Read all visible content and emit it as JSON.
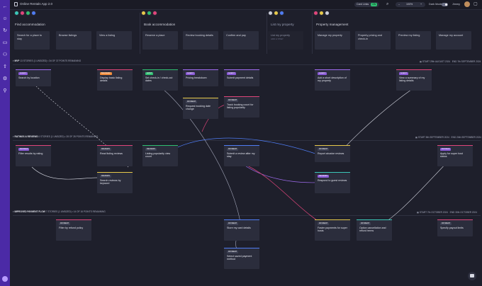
{
  "app": {
    "title": "Online Rentals App 2.0"
  },
  "topbar": {
    "card_links_label": "Card Links",
    "card_links_state": "ON",
    "zoom_out": "–",
    "zoom_level": "100%",
    "zoom_in": "+",
    "dark_mode_label": "Dark Mode",
    "user_name": "Jimmy",
    "search_icon": "search-icon"
  },
  "colors": {
    "left_rail": "#4b2aa6",
    "background": "#1e1f2b",
    "card": "#2b2d3c",
    "pink": "#e0457b",
    "green": "#2fbf71",
    "purple": "#a06cf0",
    "blue": "#4f7cf3",
    "yellow": "#e7c94a",
    "orange": "#f08b3a",
    "teal": "#3bc7b8"
  },
  "activities": [
    {
      "label": "Find accommodation"
    },
    {
      "label": "Book accommodation"
    },
    {
      "label": "List my property"
    },
    {
      "label": "Property management"
    }
  ],
  "steps": [
    {
      "label": "Search for a place to stay"
    },
    {
      "label": "Browse listings"
    },
    {
      "label": "View a listing"
    },
    {
      "label": "Reserve a place"
    },
    {
      "label": "Review booking details"
    },
    {
      "label": "Confirm and pay"
    },
    {
      "label": "List my property",
      "sub": "ADD A STEP"
    },
    {
      "label": "Manage my property"
    },
    {
      "label": "Property pricing and check-in"
    },
    {
      "label": "Preview my listing"
    },
    {
      "label": "Manage my account"
    }
  ],
  "releases": [
    {
      "name": "MVP",
      "stats": "13 STORIES (1 UNSIZED) • 34 OF 37 POINTS REMAINING",
      "start_label": "START",
      "start": "29th AUGUST 2024",
      "end_label": "END",
      "end": "7th SEPTEMBER 2024"
    },
    {
      "name": "RATINGS & REVIEWS",
      "stats": "6 STORIES (1 UNSIZED) • 28 OF 28 POINTS REMAINING",
      "start_label": "START",
      "start": "8th SEPTEMBER 2024",
      "end_label": "END",
      "end": "26th SEPTEMBER 2024"
    },
    {
      "name": "IMPROVED PAYMENT FLOW",
      "stats": "7 STORIES (1 UNSIZED) • 14 OF 16 POINTS REMAINING",
      "start_label": "START",
      "start": "7th OCTOBER 2024",
      "end_label": "END",
      "end": "30th OCTOBER 2024"
    }
  ],
  "cards": [
    {
      "tag": "GUEST",
      "text": "Search by location"
    },
    {
      "tag": "BACKEND",
      "text": "Display basic listing details"
    },
    {
      "tag": "HOST",
      "text": "Set check-in / check-out dates"
    },
    {
      "tag": "GUEST",
      "text": "Pricing breakdown"
    },
    {
      "tag": "GUEST",
      "text": "Submit payment details"
    },
    {
      "tag": "PAYMENT",
      "text": "Request booking date change"
    },
    {
      "tag": "PAYMENT",
      "text": "Track booking count for listing popularity"
    },
    {
      "tag": "GUEST",
      "text": "Add a short description of my property"
    },
    {
      "tag": "GUEST",
      "text": "View a summary of my listing details"
    },
    {
      "tag": "RATINGS",
      "text": "Filter results by rating"
    },
    {
      "tag": "REVIEWS",
      "text": "Read listing reviews"
    },
    {
      "tag": "REVIEWS",
      "text": "Listing popularity view count"
    },
    {
      "tag": "PAYMENT",
      "text": "Submit a review after my stay"
    },
    {
      "tag": "REVIEWS",
      "text": "Search reviews by keyword"
    },
    {
      "tag": "PAYMENT",
      "text": "Report abusive reviews"
    },
    {
      "tag": "RATINGS",
      "text": "Apply for super host status"
    },
    {
      "tag": "REVIEWS",
      "text": "Respond to guest reviews"
    },
    {
      "tag": "PAYMENT",
      "text": "Filter by refund policy"
    },
    {
      "tag": "PAYMENT",
      "text": "Store my card details"
    },
    {
      "tag": "PAYMENT",
      "text": "Faster payments for super hosts"
    },
    {
      "tag": "PAYMENT",
      "text": "Option cancellation and refund terms"
    },
    {
      "tag": "PAYMENT",
      "text": "Specify payout limits"
    },
    {
      "tag": "PAYMENT",
      "text": "Select saved payment method"
    }
  ]
}
